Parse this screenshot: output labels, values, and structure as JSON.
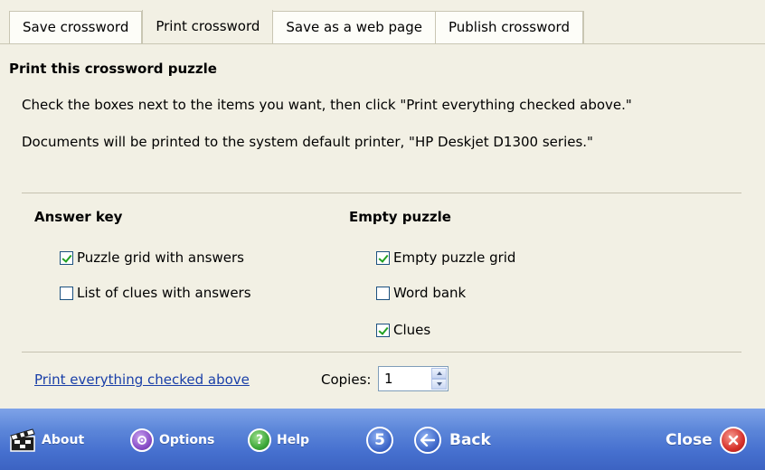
{
  "tabs": [
    {
      "label": "Save crossword",
      "active": false
    },
    {
      "label": "Print crossword",
      "active": true
    },
    {
      "label": "Save as a web page",
      "active": false
    },
    {
      "label": "Publish crossword",
      "active": false
    }
  ],
  "panel": {
    "title": "Print this crossword puzzle",
    "instructions": "Check the boxes next to the items you want, then click \"Print everything checked above.\"",
    "printer_note": "Documents will be printed to the system default printer, \"HP Deskjet D1300 series.\""
  },
  "answer_key": {
    "heading": "Answer key",
    "items": [
      {
        "label": "Puzzle grid with answers",
        "checked": true
      },
      {
        "label": "List of clues with answers",
        "checked": false
      }
    ]
  },
  "empty_puzzle": {
    "heading": "Empty puzzle",
    "items": [
      {
        "label": "Empty puzzle grid",
        "checked": true
      },
      {
        "label": "Word bank",
        "checked": false
      },
      {
        "label": "Clues",
        "checked": true
      }
    ]
  },
  "print": {
    "link_label": "Print everything checked above",
    "copies_label": "Copies:",
    "copies_value": "1"
  },
  "bottom_bar": {
    "about": {
      "label": "About",
      "icon": "film-clapper-icon"
    },
    "options": {
      "label": "Options",
      "icon": "options-icon"
    },
    "help": {
      "label": "Help",
      "icon": "help-icon"
    },
    "step_number": "5",
    "back": {
      "label": "Back",
      "icon": "back-arrow-icon"
    },
    "close": {
      "label": "Close",
      "icon": "close-icon"
    }
  },
  "colors": {
    "accent_bar": "#4670cf",
    "link": "#1a3fa8",
    "check": "#21a121",
    "close_red": "#d7312a",
    "options_purple": "#8a4fc8",
    "help_green": "#3ea83a",
    "panel_bg": "#f2f0e4"
  }
}
